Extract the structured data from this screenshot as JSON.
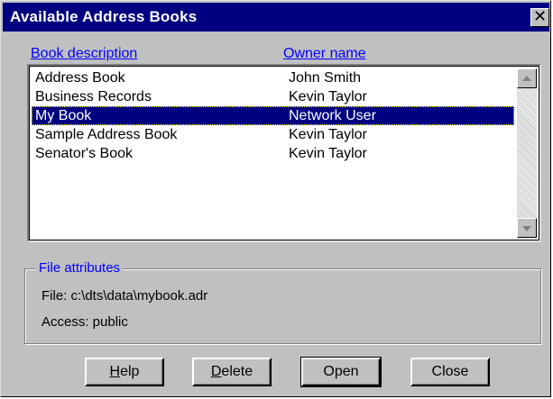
{
  "window": {
    "title": "Available Address Books",
    "close_glyph": "✕"
  },
  "columns": {
    "book_description": {
      "accel": "B",
      "rest": "ook description"
    },
    "owner_name": {
      "accel": "",
      "rest": "Owner name"
    }
  },
  "books": [
    {
      "description": "Address Book",
      "owner": "John Smith",
      "selected": false
    },
    {
      "description": "Business Records",
      "owner": "Kevin Taylor",
      "selected": false
    },
    {
      "description": "My Book",
      "owner": "Network User",
      "selected": true
    },
    {
      "description": "Sample Address Book",
      "owner": "Kevin Taylor",
      "selected": false
    },
    {
      "description": "Senator's Book",
      "owner": "Kevin Taylor",
      "selected": false
    }
  ],
  "file_attributes": {
    "label": "File attributes",
    "file_line": "File: c:\\dts\\data\\mybook.adr",
    "access_line": "Access: public"
  },
  "buttons": {
    "help": {
      "accel": "H",
      "rest": "elp"
    },
    "delete": {
      "accel": "D",
      "rest": "elete"
    },
    "open": {
      "accel": "",
      "rest": "Open"
    },
    "close": {
      "accel": "",
      "rest": "Close"
    }
  },
  "colors": {
    "titlebar": "#000080",
    "face": "#c0c0c0",
    "selection": "#000080",
    "link_blue": "#0000ff"
  }
}
